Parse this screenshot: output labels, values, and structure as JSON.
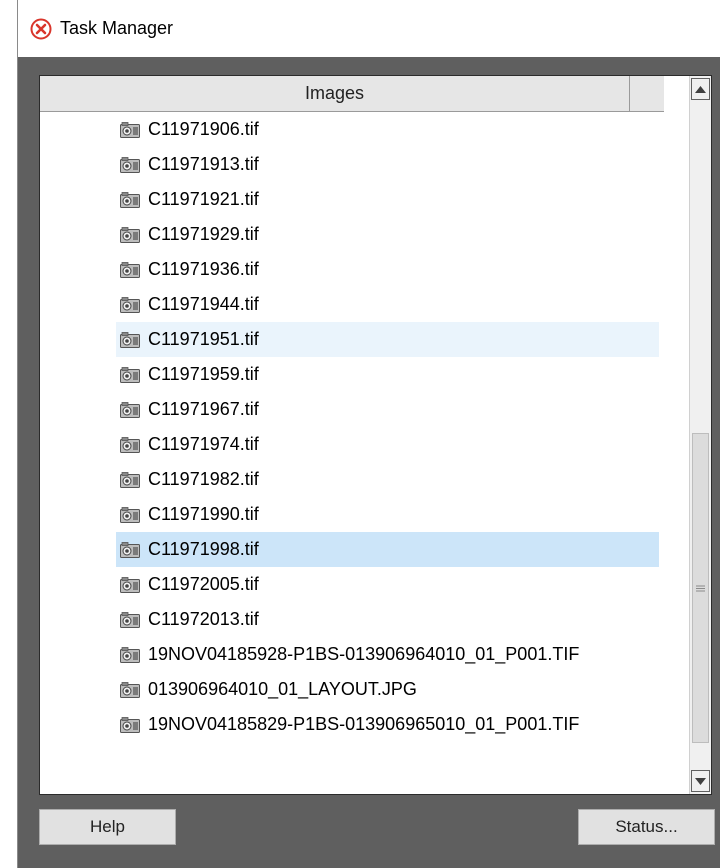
{
  "window": {
    "title": "Task Manager",
    "title_icon": "red-x-circle-icon"
  },
  "list": {
    "column_header": "Images",
    "item_icon": "image-file-icon",
    "items": [
      {
        "name": "C11971906.tif",
        "state": "normal"
      },
      {
        "name": "C11971913.tif",
        "state": "normal"
      },
      {
        "name": "C11971921.tif",
        "state": "normal"
      },
      {
        "name": "C11971929.tif",
        "state": "normal"
      },
      {
        "name": "C11971936.tif",
        "state": "normal"
      },
      {
        "name": "C11971944.tif",
        "state": "normal"
      },
      {
        "name": "C11971951.tif",
        "state": "hover"
      },
      {
        "name": "C11971959.tif",
        "state": "normal"
      },
      {
        "name": "C11971967.tif",
        "state": "normal"
      },
      {
        "name": "C11971974.tif",
        "state": "normal"
      },
      {
        "name": "C11971982.tif",
        "state": "normal"
      },
      {
        "name": "C11971990.tif",
        "state": "normal"
      },
      {
        "name": "C11971998.tif",
        "state": "selected"
      },
      {
        "name": "C11972005.tif",
        "state": "normal"
      },
      {
        "name": "C11972013.tif",
        "state": "normal"
      },
      {
        "name": "19NOV04185928-P1BS-013906964010_01_P001.TIF",
        "state": "normal"
      },
      {
        "name": "013906964010_01_LAYOUT.JPG",
        "state": "normal"
      },
      {
        "name": "19NOV04185829-P1BS-013906965010_01_P001.TIF",
        "state": "normal"
      }
    ]
  },
  "buttons": {
    "help": "Help",
    "status": "Status..."
  },
  "colors": {
    "hover_row": "#eaf4fc",
    "selected_row": "#cce5f9",
    "close_icon": "#d9352b"
  }
}
